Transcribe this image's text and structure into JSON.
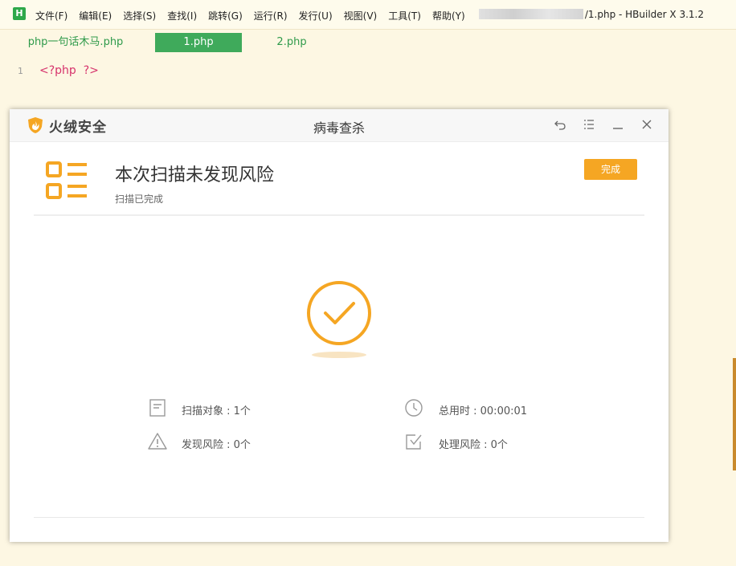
{
  "editor": {
    "app_logo_letter": "H",
    "menu": [
      "文件(F)",
      "编辑(E)",
      "选择(S)",
      "查找(I)",
      "跳转(G)",
      "运行(R)",
      "发行(U)",
      "视图(V)",
      "工具(T)",
      "帮助(Y)"
    ],
    "window_title": "/1.php - HBuilder X 3.1.2",
    "tabs": [
      "php一句话木马.php",
      "1.php",
      "2.php"
    ],
    "active_tab_index": 1,
    "line_number": "1",
    "code_line": "<?php  ?>"
  },
  "dialog": {
    "brand": "火绒安全",
    "title": "病毒查杀",
    "controls": [
      "back-icon",
      "menu-icon",
      "minimize-icon",
      "close-icon"
    ],
    "headline": "本次扫描未发现风险",
    "subline": "扫描已完成",
    "done_button": "完成",
    "stats": {
      "scan_objects": "扫描对象 : 1个",
      "total_time": "总用时 : 00:00:01",
      "risks_found": "发现风险 : 0个",
      "risks_handled": "处理风险 : 0个"
    }
  },
  "colors": {
    "accent_orange": "#f5a623",
    "editor_green": "#3faa5b",
    "code_pink": "#d6336c"
  }
}
